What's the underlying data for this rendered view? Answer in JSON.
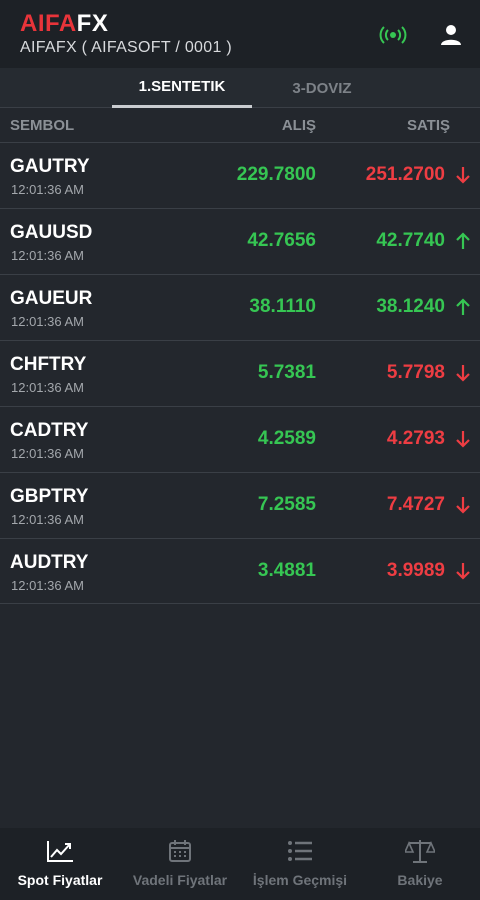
{
  "header": {
    "logo_red": "AIFA",
    "logo_white": "FX",
    "subtitle": "AIFAFX  ( AIFASOFT / 0001 )",
    "signal_icon": "signal-broadcast-icon",
    "user_icon": "user-profile-icon"
  },
  "tabs": [
    {
      "label": "1.SENTETIK",
      "active": true
    },
    {
      "label": "3-DOVIZ",
      "active": false
    }
  ],
  "columns": {
    "symbol": "SEMBOL",
    "bid": "ALIŞ",
    "ask": "SATIŞ"
  },
  "quotes": [
    {
      "symbol": "GAUTRY",
      "time": "12:01:36 AM",
      "bid": "229.7800",
      "ask": "251.2700",
      "trend": "down"
    },
    {
      "symbol": "GAUUSD",
      "time": "12:01:36 AM",
      "bid": "42.7656",
      "ask": "42.7740",
      "trend": "up"
    },
    {
      "symbol": "GAUEUR",
      "time": "12:01:36 AM",
      "bid": "38.1110",
      "ask": "38.1240",
      "trend": "up"
    },
    {
      "symbol": "CHFTRY",
      "time": "12:01:36 AM",
      "bid": "5.7381",
      "ask": "5.7798",
      "trend": "down"
    },
    {
      "symbol": "CADTRY",
      "time": "12:01:36 AM",
      "bid": "4.2589",
      "ask": "4.2793",
      "trend": "down"
    },
    {
      "symbol": "GBPTRY",
      "time": "12:01:36 AM",
      "bid": "7.2585",
      "ask": "7.4727",
      "trend": "down"
    },
    {
      "symbol": "AUDTRY",
      "time": "12:01:36 AM",
      "bid": "3.4881",
      "ask": "3.9989",
      "trend": "down"
    }
  ],
  "colors": {
    "up": "#36c653",
    "down": "#ee3d43",
    "brand": "#e8343a"
  },
  "bottom_nav": [
    {
      "label": "Spot Fiyatlar",
      "icon": "line-chart-icon",
      "active": true
    },
    {
      "label": "Vadeli Fiyatlar",
      "icon": "calendar-icon",
      "active": false
    },
    {
      "label": "İşlem Geçmişi",
      "icon": "list-icon",
      "active": false
    },
    {
      "label": "Bakiye",
      "icon": "balance-scale-icon",
      "active": false
    }
  ]
}
